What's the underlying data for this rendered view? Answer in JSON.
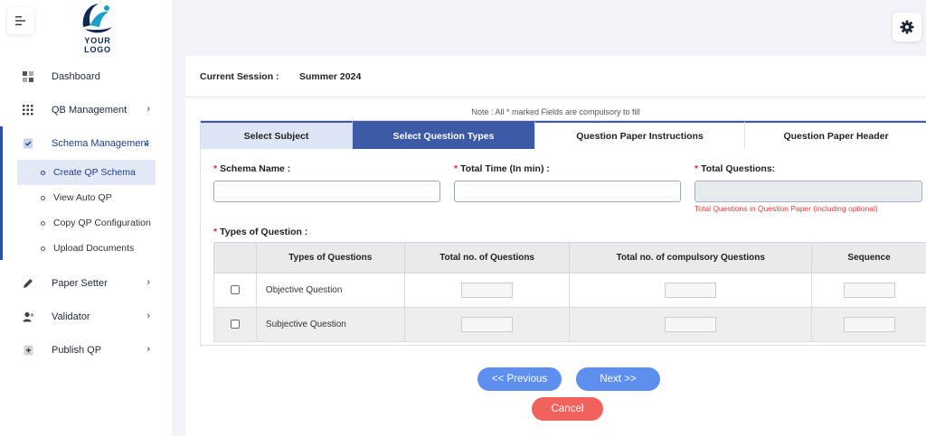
{
  "logo": {
    "text": "YOUR LOGO"
  },
  "sidebar": {
    "items": [
      {
        "label": "Dashboard",
        "icon": "dashboard-icon"
      },
      {
        "label": "QB Management",
        "icon": "grid-icon"
      },
      {
        "label": "Schema Management",
        "icon": "clipboard-check-icon"
      },
      {
        "label": "Paper Setter",
        "icon": "pencil-icon"
      },
      {
        "label": "Validator",
        "icon": "user-plus-icon"
      },
      {
        "label": "Publish QP",
        "icon": "document-plus-icon"
      }
    ],
    "sub_items": [
      {
        "label": "Create QP Schema"
      },
      {
        "label": "View Auto QP"
      },
      {
        "label": "Copy QP Configuration"
      },
      {
        "label": "Upload Documents"
      }
    ]
  },
  "session": {
    "label": "Current Session :",
    "value": "Summer 2024"
  },
  "note": "Note : All * marked Fields are compulsory to fill",
  "tabs": [
    {
      "label": "Select Subject"
    },
    {
      "label": "Select Question Types"
    },
    {
      "label": "Question Paper Instructions"
    },
    {
      "label": "Question Paper Header"
    }
  ],
  "form": {
    "schema_name_label": "Schema Name :",
    "total_time_label": "Total Time (In min) :",
    "total_questions_label": "Total Questions:",
    "total_questions_hint": "Total Questions in Question Paper (including optional)",
    "types_label": "Types of Question :",
    "required_mark": "*"
  },
  "table": {
    "headers": [
      "",
      "Types of Questions",
      "Total no. of Questions",
      "Total no. of compulsory Questions",
      "Sequence"
    ],
    "rows": [
      {
        "name": "Objective Question"
      },
      {
        "name": "Subjective Question"
      }
    ]
  },
  "buttons": {
    "previous": "<< Previous",
    "next": "Next >>",
    "cancel": "Cancel"
  },
  "colors": {
    "accent": "#3d5aa7",
    "button_blue": "#5d8ef0",
    "cancel_red": "#f1625d",
    "required_red": "#d32f2f"
  }
}
